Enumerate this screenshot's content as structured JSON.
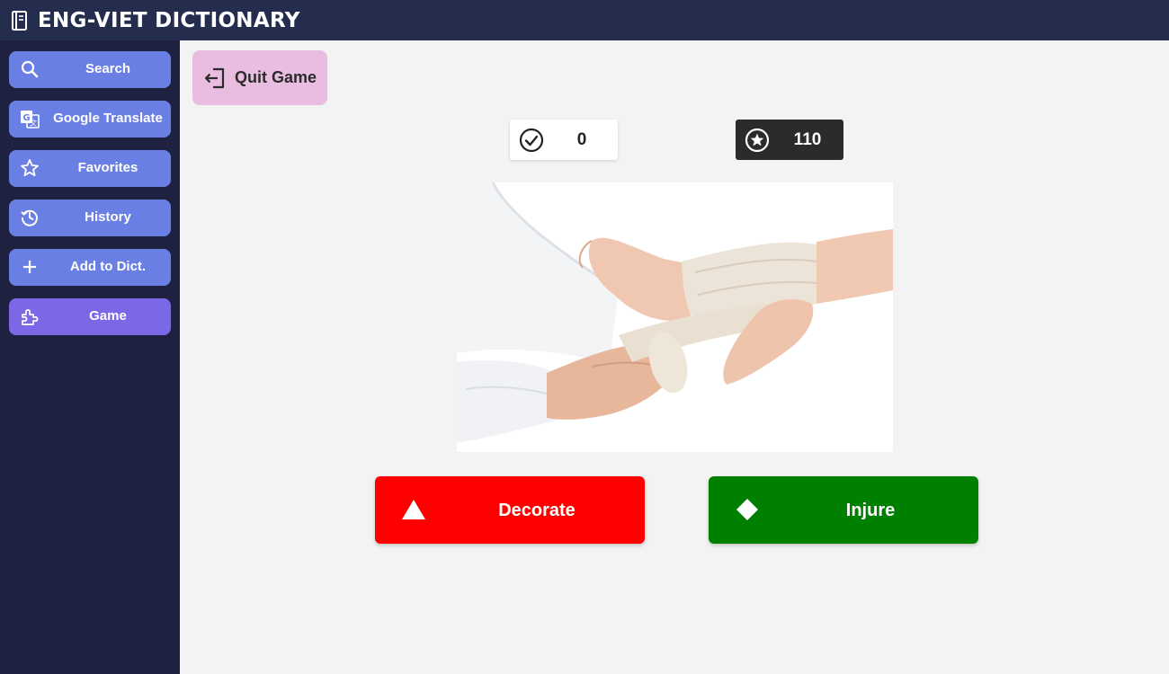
{
  "app": {
    "title": "ENG-VIET DICTIONARY",
    "logo_icon": "book-icon"
  },
  "sidebar": {
    "items": [
      {
        "label": "Search",
        "icon": "search-icon"
      },
      {
        "label": "Google Translate",
        "icon": "translate-icon"
      },
      {
        "label": "Favorites",
        "icon": "star-outline-icon"
      },
      {
        "label": "History",
        "icon": "history-icon"
      },
      {
        "label": "Add to Dict.",
        "icon": "plus-icon"
      },
      {
        "label": "Game",
        "icon": "puzzle-icon",
        "active": true
      }
    ],
    "colors": {
      "item": "#6a7fe4",
      "active": "#7a68e6"
    }
  },
  "game": {
    "quit_label": "Quit Game",
    "correct_count": "0",
    "points": "110",
    "image_subject": "hands bandaging an injured ankle",
    "answers": [
      {
        "label": "Decorate",
        "icon": "triangle-icon",
        "color": "#ff0000"
      },
      {
        "label": "Injure",
        "icon": "diamond-icon",
        "color": "#008000"
      }
    ]
  }
}
